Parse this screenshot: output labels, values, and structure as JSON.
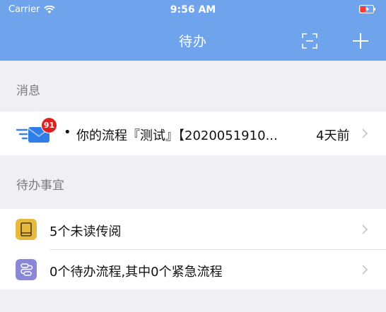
{
  "status_bar": {
    "carrier": "Carrier",
    "time": "9:56 AM"
  },
  "nav": {
    "title": "待办",
    "icons": [
      "scan-icon",
      "add-icon"
    ]
  },
  "messages_section": {
    "header": "消息",
    "item": {
      "badge": "91",
      "bullet": "•",
      "text": "你的流程『测试』【2020051910...",
      "time": "4天前"
    }
  },
  "todo_section": {
    "header": "待办事宜",
    "items": [
      {
        "label": "5个未读传阅",
        "icon": "book-icon",
        "color": "#e8b93f"
      },
      {
        "label": "0个待办流程,其中0个紧急流程",
        "icon": "flow-icon",
        "color": "#8a86d8"
      }
    ]
  },
  "colors": {
    "nav_bar": "#6fa4ec",
    "badge": "#e0201c",
    "background": "#efeff4"
  }
}
